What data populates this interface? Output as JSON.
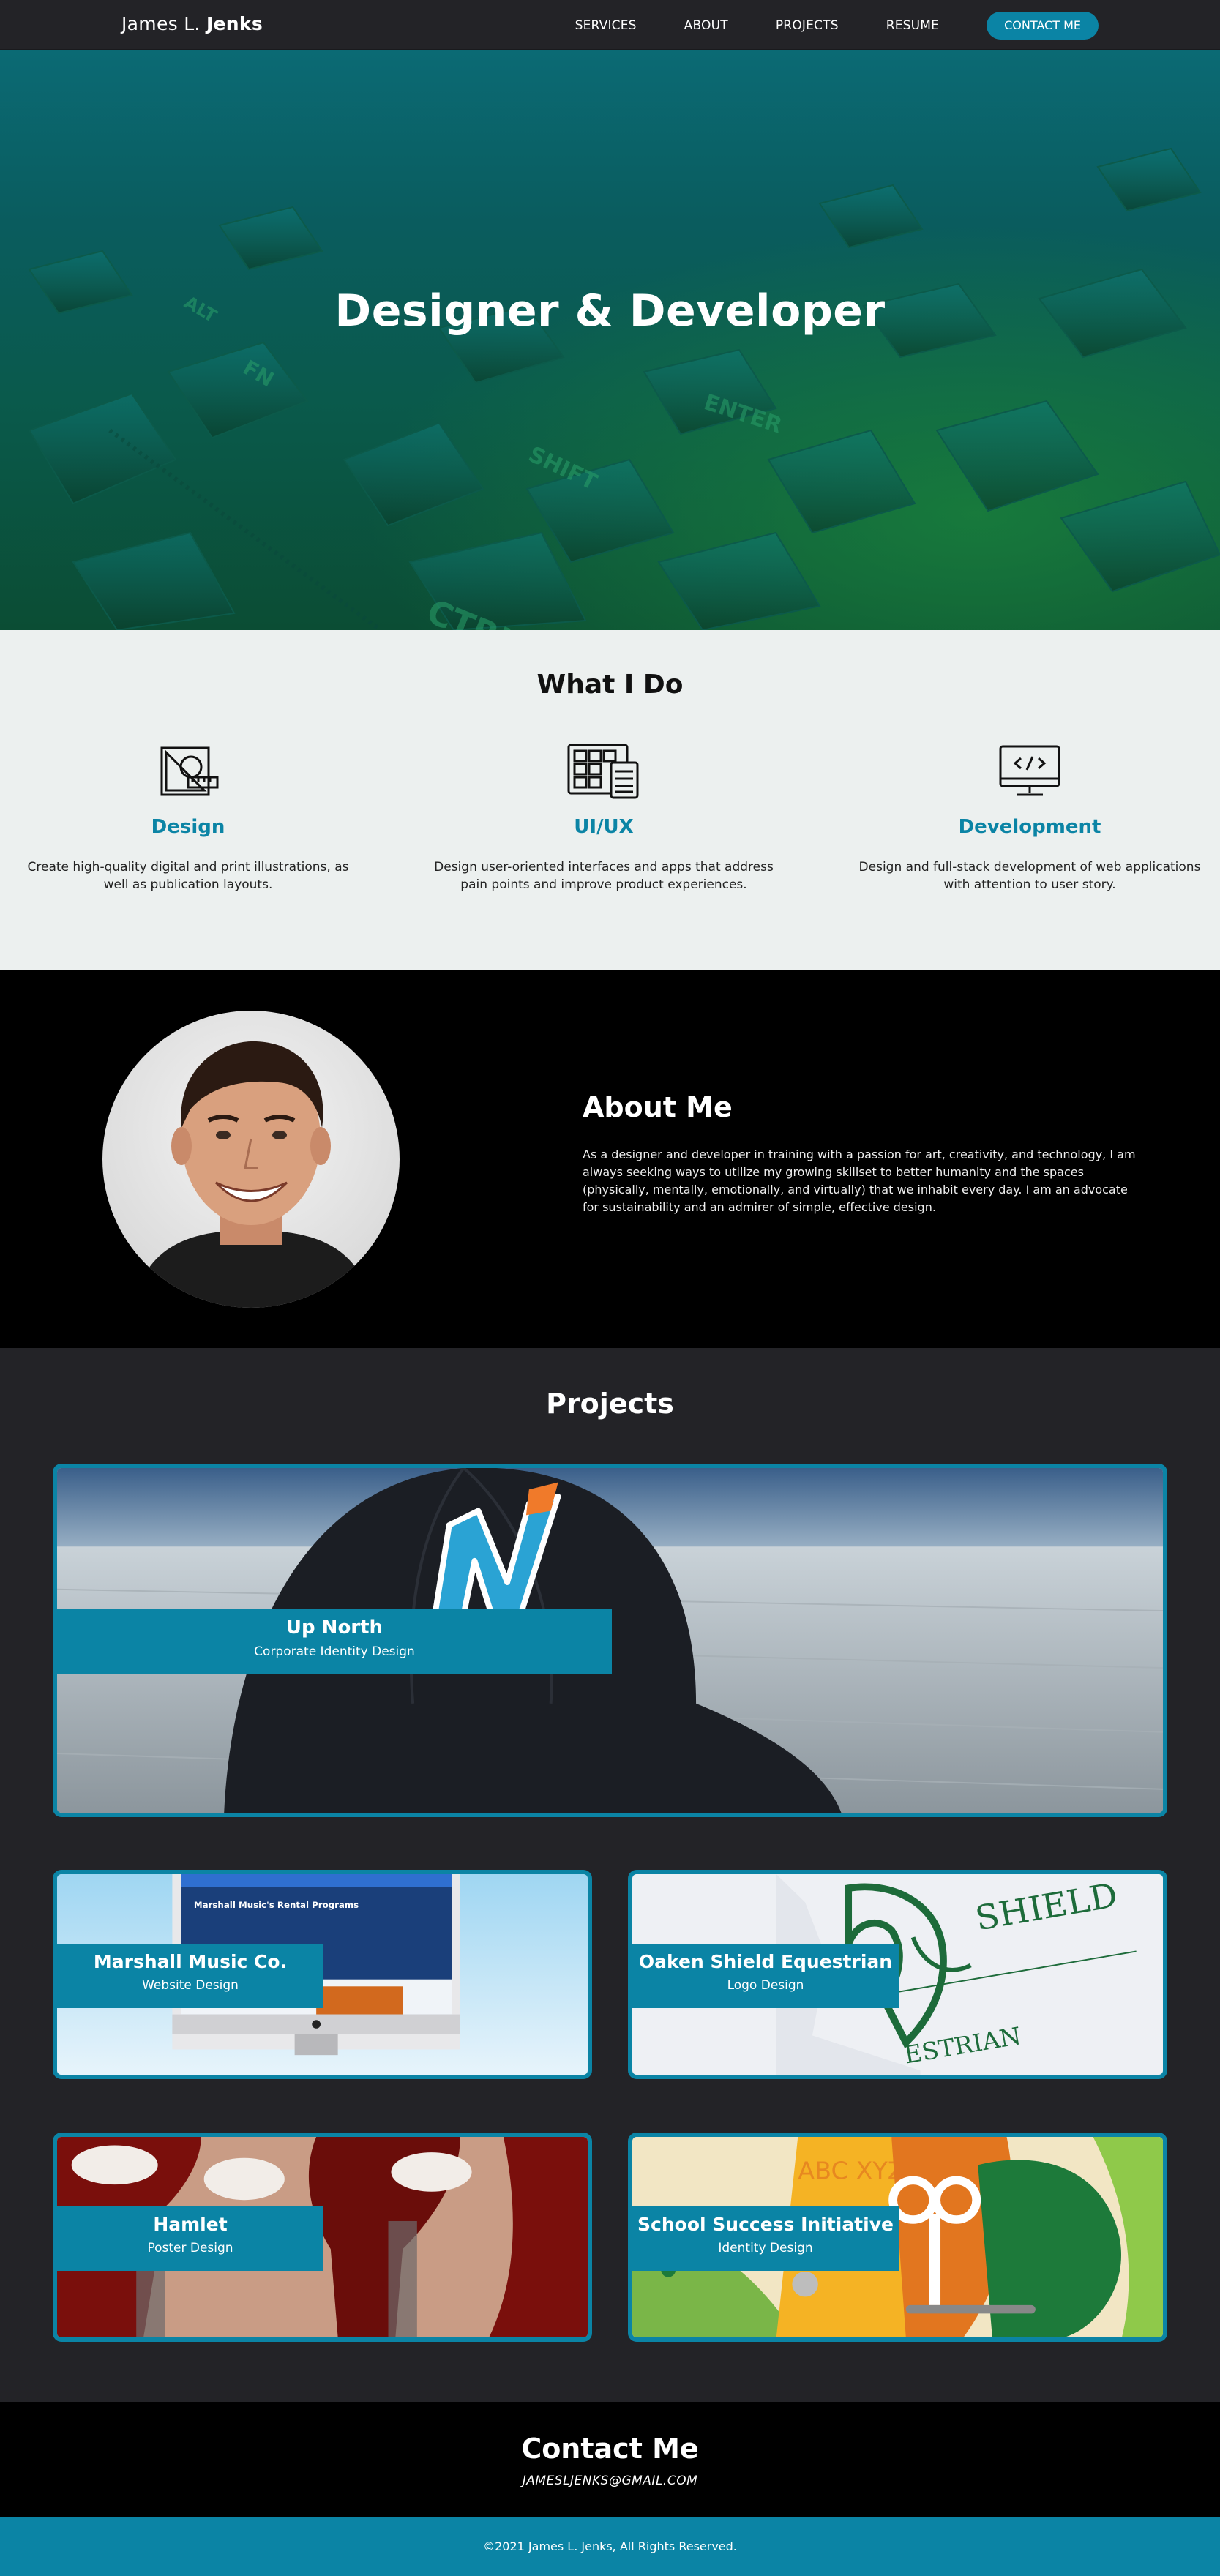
{
  "nav": {
    "brand_first": "James L.",
    "brand_last": "Jenks",
    "links": [
      "SERVICES",
      "ABOUT",
      "PROJECTS",
      "RESUME"
    ],
    "contact_label": "CONTACT ME"
  },
  "hero": {
    "title": "Designer & Developer",
    "keycaps": [
      "ENTER",
      "SHIFT",
      "CTRL",
      "FN",
      "ALT"
    ]
  },
  "services": {
    "title": "What I Do",
    "items": [
      {
        "icon": "design-tools-icon",
        "title": "Design",
        "text": "Create high-quality digital and print illustrations, as well as publication layouts."
      },
      {
        "icon": "layout-grid-icon",
        "title": "UI/UX",
        "text": "Design user-oriented interfaces and apps that address pain points and improve product experiences."
      },
      {
        "icon": "code-monitor-icon",
        "title": "Development",
        "text": "Design and full-stack development of web applications with attention to user story."
      }
    ]
  },
  "about": {
    "title": "About Me",
    "text": "As a designer and developer in training with a passion for art, creativity, and technology, I am always seeking ways to utilize my growing skillset to better humanity and the spaces (physically, mentally, emotionally, and virtually) that we inhabit every day. I am an advocate for sustainability and an admirer of simple, effective design."
  },
  "projects": {
    "title": "Projects",
    "items": [
      {
        "title": "Up North",
        "subtitle": "Corporate Identity Design"
      },
      {
        "title": "Marshall Music Co.",
        "subtitle": "Website Design",
        "screen_heading": "Marshall Music's Rental Programs"
      },
      {
        "title": "Oaken Shield Equestrian",
        "subtitle": "Logo Design",
        "logo_text_top": "SHIELD",
        "logo_text_bottom": "ESTRIAN"
      },
      {
        "title": "Hamlet",
        "subtitle": "Poster Design"
      },
      {
        "title": "School Success Initiative",
        "subtitle": "Identity Design",
        "poster_letters": "ABC XYZ"
      }
    ]
  },
  "contact": {
    "title": "Contact Me",
    "email": "JAMESLJENKS@GMAIL.COM"
  },
  "footer": {
    "copyright": "©2021 James L. Jenks, All Rights Reserved."
  },
  "colors": {
    "accent": "#0b84a5",
    "nav_bg": "#232327",
    "services_bg": "#ecf0ef",
    "about_bg": "#000000"
  }
}
